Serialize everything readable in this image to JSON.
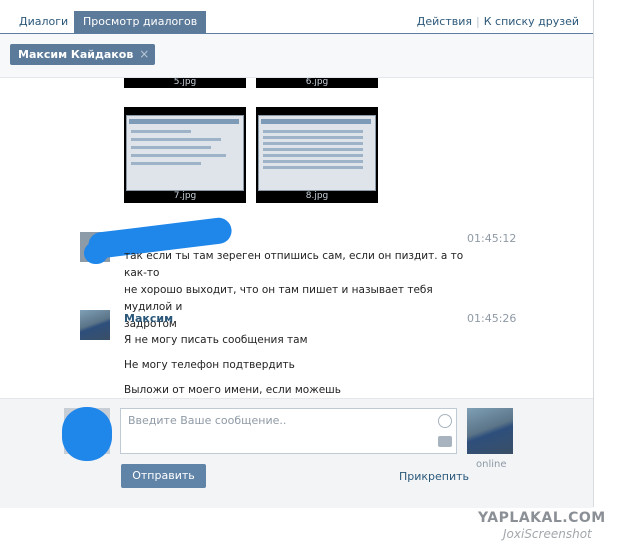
{
  "tabs": [
    "Диалоги",
    "Просмотр диалогов"
  ],
  "top_links": {
    "actions": "Действия",
    "friends": "К списку друзей"
  },
  "chip": {
    "name": "Максим Кайдаков",
    "close": "×"
  },
  "attachments": {
    "upper_captions": [
      "5.jpg",
      "6.jpg"
    ],
    "captions": [
      "7.jpg",
      "8.jpg"
    ]
  },
  "messages": [
    {
      "time": "01:45:12",
      "author": "",
      "lines": [
        "так если ты там зереген отпишись сам, если он пиздит. а то как-то",
        "не хорошо выходит, что он там пишет и называет тебя мудилой и",
        "задротом"
      ]
    },
    {
      "time": "01:45:26",
      "author": "Максим",
      "lines": [
        "Я не могу писать сообщения там",
        "Не могу телефон подтвердить",
        "Выложи от моего имени, если можешь"
      ]
    }
  ],
  "composer": {
    "placeholder": "Введите Ваше сообщение..",
    "send": "Отправить",
    "attach": "Прикрепить",
    "status": "online"
  },
  "watermark": {
    "line1": "YAPLAKAL.COM",
    "line2": "JoxiScreenshot"
  },
  "colors": {
    "accent": "#5c7a99",
    "link": "#2b587a",
    "blot": "#1f86ea"
  }
}
